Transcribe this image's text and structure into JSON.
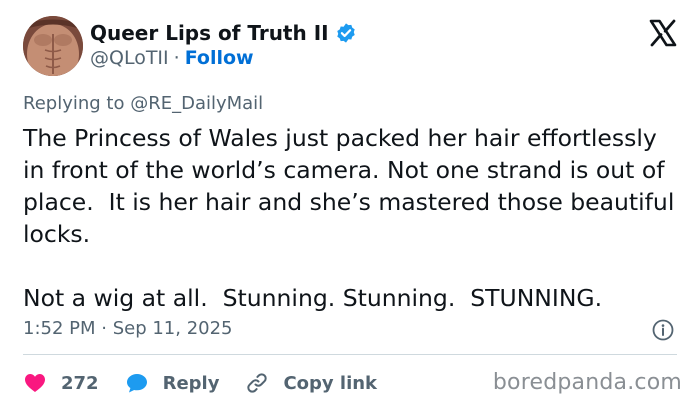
{
  "author": {
    "display_name": "Queer Lips of Truth II",
    "handle": "@QLoTII",
    "separator": "·",
    "follow_label": "Follow",
    "verified": true
  },
  "reply_context": "Replying to @RE_DailyMail",
  "tweet": {
    "text": "The Princess of Wales just packed her hair effortlessly in front of the world’s camera. Not one strand is out of place.  It is her hair and she’s mastered those beautiful locks.\n\nNot a wig at all.  Stunning. Stunning.  STUNNING."
  },
  "timestamp": "1:52 PM · Sep 11, 2025",
  "actions": {
    "like_count": "272",
    "reply_label": "Reply",
    "copy_link_label": "Copy link"
  },
  "watermark": "boredpanda.com",
  "icons": {
    "logo": "x-logo-icon",
    "verified": "verified-badge-icon",
    "info": "info-icon",
    "like": "heart-icon",
    "reply": "speech-bubble-icon",
    "copy_link": "link-icon"
  },
  "colors": {
    "like": "#f91880",
    "reply": "#1d9bf0",
    "follow": "#006fd6",
    "verified": "#1d9bf0",
    "muted_text": "#536471",
    "text": "#0f1419",
    "watermark": "#8a8f94"
  }
}
